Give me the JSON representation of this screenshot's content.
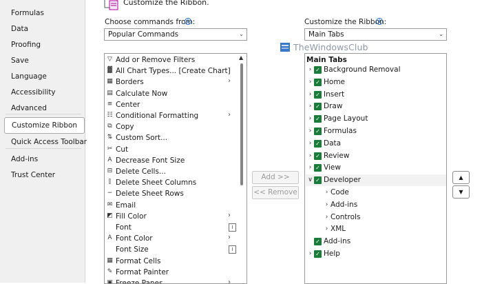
{
  "sidebar": {
    "items": [
      {
        "label": "Formulas"
      },
      {
        "label": "Data"
      },
      {
        "label": "Proofing"
      },
      {
        "label": "Save"
      },
      {
        "label": "Language"
      },
      {
        "label": "Accessibility"
      },
      {
        "label": "Advanced"
      },
      {
        "label": "Customize Ribbon",
        "selected": true
      },
      {
        "label": "Quick Access Toolbar"
      },
      {
        "label": "Add-ins"
      },
      {
        "label": "Trust Center"
      }
    ]
  },
  "heading": {
    "text": "Customize the Ribbon."
  },
  "left_panel": {
    "label": "Choose commands from:",
    "dropdown_value": "Popular Commands",
    "commands": [
      {
        "label": "Add or Remove Filters",
        "icon": "filter-icon"
      },
      {
        "label": "All Chart Types... [Create Chart]",
        "icon": "chart-icon"
      },
      {
        "label": "Borders",
        "icon": "borders-icon",
        "sub": "submenu"
      },
      {
        "label": "Calculate Now",
        "icon": "calculator-icon"
      },
      {
        "label": "Center",
        "icon": "align-center-icon"
      },
      {
        "label": "Conditional Formatting",
        "icon": "conditional-formatting-icon",
        "sub": "submenu"
      },
      {
        "label": "Copy",
        "icon": "copy-icon"
      },
      {
        "label": "Custom Sort...",
        "icon": "sort-icon"
      },
      {
        "label": "Cut",
        "icon": "scissors-icon"
      },
      {
        "label": "Decrease Font Size",
        "icon": "decrease-font-icon"
      },
      {
        "label": "Delete Cells...",
        "icon": "delete-cells-icon"
      },
      {
        "label": "Delete Sheet Columns",
        "icon": "delete-columns-icon"
      },
      {
        "label": "Delete Sheet Rows",
        "icon": "delete-rows-icon"
      },
      {
        "label": "Email",
        "icon": "email-icon"
      },
      {
        "label": "Fill Color",
        "icon": "fill-color-icon",
        "sub": "submenu"
      },
      {
        "label": "Font",
        "icon": "",
        "sub": "box"
      },
      {
        "label": "Font Color",
        "icon": "font-color-icon",
        "sub": "submenu"
      },
      {
        "label": "Font Size",
        "icon": "",
        "sub": "box"
      },
      {
        "label": "Format Cells",
        "icon": "format-cells-icon"
      },
      {
        "label": "Format Painter",
        "icon": "format-painter-icon"
      },
      {
        "label": "Freeze Panes",
        "icon": "freeze-panes-icon",
        "sub": "submenu"
      }
    ]
  },
  "buttons": {
    "add": "Add >>",
    "remove": "<< Remove"
  },
  "right_panel": {
    "label": "Customize the Ribbon:",
    "dropdown_value": "Main Tabs",
    "tree_heading": "Main Tabs",
    "tabs": [
      {
        "label": "Background Removal",
        "level": 0,
        "state": "collapsed",
        "checked": true
      },
      {
        "label": "Home",
        "level": 0,
        "state": "collapsed",
        "checked": true
      },
      {
        "label": "Insert",
        "level": 0,
        "state": "collapsed",
        "checked": true
      },
      {
        "label": "Draw",
        "level": 0,
        "state": "collapsed",
        "checked": true
      },
      {
        "label": "Page Layout",
        "level": 0,
        "state": "collapsed",
        "checked": true
      },
      {
        "label": "Formulas",
        "level": 0,
        "state": "collapsed",
        "checked": true
      },
      {
        "label": "Data",
        "level": 0,
        "state": "collapsed",
        "checked": true
      },
      {
        "label": "Review",
        "level": 0,
        "state": "collapsed",
        "checked": true
      },
      {
        "label": "View",
        "level": 0,
        "state": "collapsed",
        "checked": true
      },
      {
        "label": "Developer",
        "level": 0,
        "state": "expanded",
        "checked": true,
        "selected": true
      },
      {
        "label": "Code",
        "level": 1,
        "state": "collapsed"
      },
      {
        "label": "Add-ins",
        "level": 1,
        "state": "collapsed"
      },
      {
        "label": "Controls",
        "level": 1,
        "state": "collapsed"
      },
      {
        "label": "XML",
        "level": 1,
        "state": "collapsed"
      },
      {
        "label": "Add-ins",
        "level": 0,
        "state": "none",
        "checked": true
      },
      {
        "label": "Help",
        "level": 0,
        "state": "collapsed",
        "checked": true
      }
    ]
  },
  "watermark": {
    "text": "TheWindowsClub"
  },
  "colors": {
    "checkbox": "#1b7b3a",
    "watermark": "#8d98a6",
    "sidebar_bg": "#f0f0f0"
  }
}
